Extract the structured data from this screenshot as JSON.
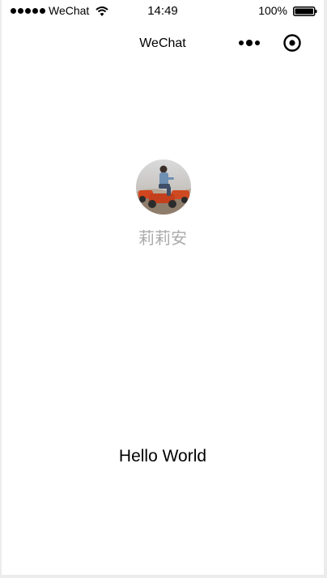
{
  "status_bar": {
    "carrier": "WeChat",
    "time": "14:49",
    "battery_percent": "100%",
    "icons": [
      "signal-icon",
      "wifi-icon",
      "battery-icon"
    ]
  },
  "nav": {
    "title": "WeChat",
    "more_icon": "more-dots-icon",
    "close_icon": "target-circle-icon"
  },
  "user": {
    "nickname": "莉莉安",
    "avatar_icon": "user-avatar-photo"
  },
  "main": {
    "motto": "Hello World"
  },
  "colors": {
    "background": "#ffffff",
    "frame": "#ececec",
    "nickname": "#aaaaaa",
    "text": "#000000"
  }
}
